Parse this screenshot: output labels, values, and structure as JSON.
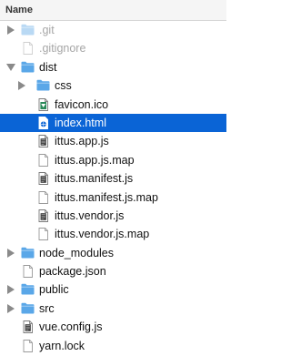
{
  "header": {
    "title": "Name"
  },
  "colors": {
    "folder": "#5aa7e8",
    "folder_dim": "#b9d9f4",
    "selection": "#0a64d6"
  },
  "items": [
    {
      "label": ".git",
      "kind": "folder",
      "depth": 0,
      "expanded": false,
      "dim": true,
      "selected": false,
      "icon": "folder-icon"
    },
    {
      "label": ".gitignore",
      "kind": "file",
      "depth": 0,
      "dim": true,
      "selected": false,
      "icon": "file-icon"
    },
    {
      "label": "dist",
      "kind": "folder",
      "depth": 0,
      "expanded": true,
      "dim": false,
      "selected": false,
      "icon": "folder-icon"
    },
    {
      "label": "css",
      "kind": "folder",
      "depth": 1,
      "expanded": false,
      "dim": false,
      "selected": false,
      "icon": "folder-icon"
    },
    {
      "label": "favicon.ico",
      "kind": "image",
      "depth": 1,
      "dim": false,
      "selected": false,
      "icon": "image-file-icon"
    },
    {
      "label": "index.html",
      "kind": "html",
      "depth": 1,
      "dim": false,
      "selected": true,
      "icon": "html-file-icon"
    },
    {
      "label": "ittus.app.js",
      "kind": "script",
      "depth": 1,
      "dim": false,
      "selected": false,
      "icon": "script-file-icon"
    },
    {
      "label": "ittus.app.js.map",
      "kind": "file",
      "depth": 1,
      "dim": false,
      "selected": false,
      "icon": "file-icon"
    },
    {
      "label": "ittus.manifest.js",
      "kind": "script",
      "depth": 1,
      "dim": false,
      "selected": false,
      "icon": "script-file-icon"
    },
    {
      "label": "ittus.manifest.js.map",
      "kind": "file",
      "depth": 1,
      "dim": false,
      "selected": false,
      "icon": "file-icon"
    },
    {
      "label": "ittus.vendor.js",
      "kind": "script",
      "depth": 1,
      "dim": false,
      "selected": false,
      "icon": "script-file-icon"
    },
    {
      "label": "ittus.vendor.js.map",
      "kind": "file",
      "depth": 1,
      "dim": false,
      "selected": false,
      "icon": "file-icon"
    },
    {
      "label": "node_modules",
      "kind": "folder",
      "depth": 0,
      "expanded": false,
      "dim": false,
      "selected": false,
      "icon": "folder-icon"
    },
    {
      "label": "package.json",
      "kind": "file",
      "depth": 0,
      "dim": false,
      "selected": false,
      "icon": "file-icon"
    },
    {
      "label": "public",
      "kind": "folder",
      "depth": 0,
      "expanded": false,
      "dim": false,
      "selected": false,
      "icon": "folder-icon"
    },
    {
      "label": "src",
      "kind": "folder",
      "depth": 0,
      "expanded": false,
      "dim": false,
      "selected": false,
      "icon": "folder-icon"
    },
    {
      "label": "vue.config.js",
      "kind": "script",
      "depth": 0,
      "dim": false,
      "selected": false,
      "icon": "script-file-icon"
    },
    {
      "label": "yarn.lock",
      "kind": "file",
      "depth": 0,
      "dim": false,
      "selected": false,
      "icon": "file-icon"
    }
  ]
}
